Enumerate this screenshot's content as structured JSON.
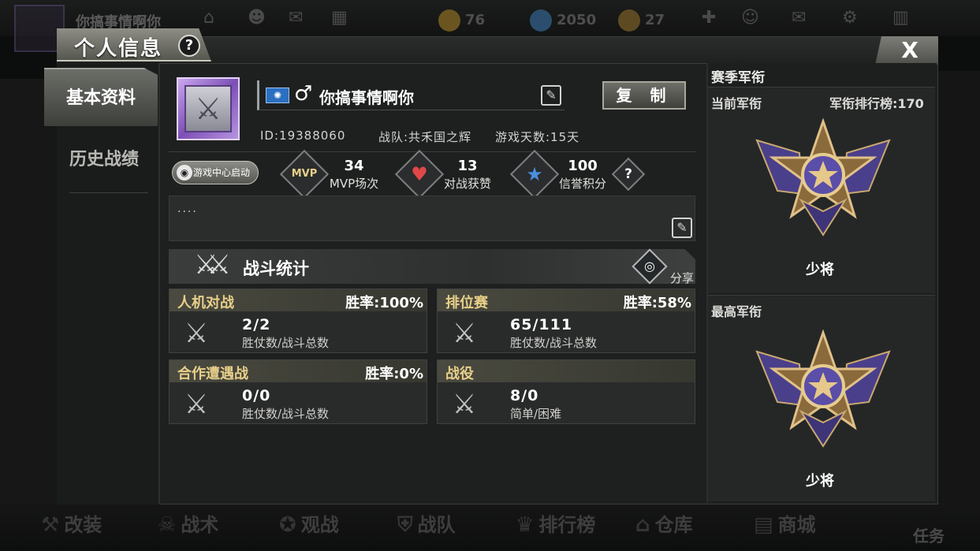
{
  "background": {
    "player_name": "你搞事情啊你",
    "gold": "76",
    "diamonds": "2050",
    "tickets": "27",
    "bottom_nav": [
      {
        "label": "改装",
        "icon": "wrench-icon"
      },
      {
        "label": "战术",
        "icon": "skull-icon"
      },
      {
        "label": "观战",
        "icon": "star-icon"
      },
      {
        "label": "战队",
        "icon": "shield-icon"
      },
      {
        "label": "排行榜",
        "icon": "trophy-icon"
      },
      {
        "label": "仓库",
        "icon": "warehouse-icon"
      },
      {
        "label": "商城",
        "icon": "shop-icon"
      }
    ],
    "task_label": "任务"
  },
  "modal": {
    "title": "个人信息",
    "help_glyph": "?",
    "close_glyph": "X",
    "tabs": [
      {
        "label": "基本资料",
        "active": true
      },
      {
        "label": "历史战绩",
        "active": false
      }
    ]
  },
  "profile": {
    "nickname": "你搞事情啊你",
    "gender_glyph": "♂",
    "copy_label": "复 制",
    "id_text": "ID:19388060",
    "team_text": "战队:共禾国之辉",
    "days_text": "游戏天数:15天",
    "game_center_label": "游戏中心启动",
    "signature": "....",
    "stats": [
      {
        "icon": "mvp-icon",
        "glyph": "MVP",
        "value": "34",
        "label": "MVP场次"
      },
      {
        "icon": "heart-icon",
        "glyph": "♥",
        "value": "13",
        "label": "对战获赞"
      },
      {
        "icon": "star-icon",
        "glyph": "★",
        "value": "100",
        "label": "信誉积分"
      }
    ]
  },
  "battle": {
    "title": "战斗统计",
    "share_label": "分享",
    "cards": [
      {
        "name": "人机对战",
        "rate": "胜率:100%",
        "value": "2/2",
        "sub": "胜仗数/战斗总数"
      },
      {
        "name": "排位赛",
        "rate": "胜率:58%",
        "value": "65/111",
        "sub": "胜仗数/战斗总数"
      },
      {
        "name": "合作遭遇战",
        "rate": "胜率:0%",
        "value": "0/0",
        "sub": "胜仗数/战斗总数"
      },
      {
        "name": "战役",
        "rate": "",
        "value": "8/0",
        "sub": "简单/困难"
      }
    ]
  },
  "season": {
    "title": "赛季军衔",
    "current_label": "当前军衔",
    "rank_board": "军衔排行榜:170",
    "current_rank": "少将",
    "highest_label": "最高军衔",
    "highest_rank": "少将"
  },
  "colors": {
    "accent_gold": "#e8cf8a",
    "heart_red": "#e04848",
    "star_blue": "#4a8fe0",
    "medal_purple": "#5b4ea8"
  }
}
